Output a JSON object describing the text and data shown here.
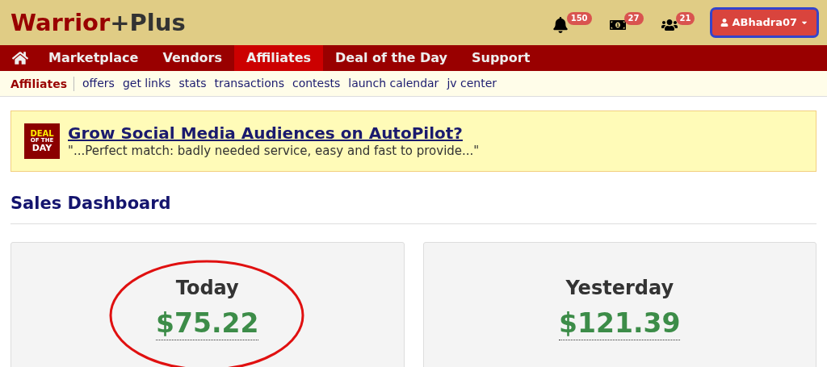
{
  "logo": {
    "primary": "Warrior",
    "secondary": "+Plus"
  },
  "header_badges": [
    {
      "kind": "bell",
      "count": "150"
    },
    {
      "kind": "money",
      "count": "27"
    },
    {
      "kind": "people",
      "count": "21"
    }
  ],
  "user_button": {
    "label": "ABhadra07",
    "highlighted": true
  },
  "nav": [
    {
      "label": "Marketplace",
      "selected": false
    },
    {
      "label": "Vendors",
      "selected": false
    },
    {
      "label": "Affiliates",
      "selected": true
    },
    {
      "label": "Deal of the Day",
      "selected": false
    },
    {
      "label": "Support",
      "selected": false
    }
  ],
  "subnav": {
    "title": "Affiliates",
    "links": [
      "offers",
      "get links",
      "stats",
      "transactions",
      "contests",
      "launch calendar",
      "jv center"
    ]
  },
  "deal": {
    "badge": [
      "DEAL",
      "OF THE",
      "DAY"
    ],
    "title": "Grow Social Media Audiences on AutoPilot?",
    "quote": "\"...Perfect match: badly needed service, easy and fast to provide...\""
  },
  "section_title": "Sales Dashboard",
  "cards": [
    {
      "label": "Today",
      "value": "$75.22",
      "circled": true
    },
    {
      "label": "Yesterday",
      "value": "$121.39",
      "circled": false
    }
  ]
}
